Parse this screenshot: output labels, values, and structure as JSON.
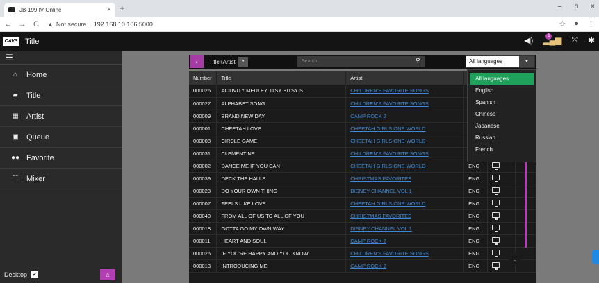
{
  "browser": {
    "tab_title": "JB-199 IV Online",
    "tab_close": "×",
    "new_tab": "+",
    "url_warning": "Not secure",
    "url_separator": "|",
    "url_host": "192.168.10.106:5000",
    "win_min": "–",
    "win_max": "ɑ",
    "win_close": "×"
  },
  "appbar": {
    "logo": "CAVS",
    "title": "Title",
    "badge_count": "1"
  },
  "sidebar": {
    "items": [
      {
        "label": "Home",
        "icon": "home-icon"
      },
      {
        "label": "Title",
        "icon": "book-icon"
      },
      {
        "label": "Artist",
        "icon": "grid-icon"
      },
      {
        "label": "Queue",
        "icon": "queue-icon"
      },
      {
        "label": "Favorite",
        "icon": "users-icon"
      },
      {
        "label": "Mixer",
        "icon": "sliders-icon"
      }
    ],
    "desktop_label": "Desktop"
  },
  "toolbar": {
    "search_type": "Title+Artist",
    "search_placeholder": "Search...",
    "language_selected": "All languages"
  },
  "table": {
    "headers": [
      "Number",
      "Title",
      "Artist"
    ],
    "rows": [
      {
        "number": "000026",
        "title": "ACTIVITY MEDLEY: ITSY BITSY S",
        "artist": "CHILDREN'S FAVORITE SONGS",
        "lang": ""
      },
      {
        "number": "000027",
        "title": "ALPHABET SONG",
        "artist": "CHILDREN'S FAVORITE SONGS",
        "lang": ""
      },
      {
        "number": "000009",
        "title": "BRAND NEW DAY",
        "artist": "CAMP ROCK 2",
        "lang": ""
      },
      {
        "number": "000001",
        "title": "CHEETAH LOVE",
        "artist": "CHEETAH GIRLS ONE WORLD",
        "lang": ""
      },
      {
        "number": "000008",
        "title": "CIRCLE GAME",
        "artist": "CHEETAH GIRLS ONE WORLD",
        "lang": ""
      },
      {
        "number": "000031",
        "title": "CLEMENTINE",
        "artist": "CHILDREN'S FAVORITE SONGS",
        "lang": ""
      },
      {
        "number": "000002",
        "title": "DANCE ME IF YOU CAN",
        "artist": "CHEETAH GIRLS ONE WORLD",
        "lang": "ENG"
      },
      {
        "number": "000039",
        "title": "DECK THE HALLS",
        "artist": "CHRISTMAS FAVORITES",
        "lang": "ENG"
      },
      {
        "number": "000023",
        "title": "DO YOUR OWN THING",
        "artist": "DISNEY CHANNEL VOL 1",
        "lang": "ENG"
      },
      {
        "number": "000007",
        "title": "FEELS LIKE LOVE",
        "artist": "CHEETAH GIRLS ONE WORLD",
        "lang": "ENG"
      },
      {
        "number": "000040",
        "title": "FROM ALL OF US TO ALL OF YOU",
        "artist": "CHRISTMAS FAVORITES",
        "lang": "ENG"
      },
      {
        "number": "000018",
        "title": "GOTTA GO MY OWN WAY",
        "artist": "DISNEY CHANNEL VOL 1",
        "lang": "ENG"
      },
      {
        "number": "000011",
        "title": "HEART AND SOUL",
        "artist": "CAMP ROCK 2",
        "lang": "ENG"
      },
      {
        "number": "000025",
        "title": "IF YOU'RE HAPPY AND YOU KNOW",
        "artist": "CHILDREN'S FAVORITE SONGS",
        "lang": "ENG"
      },
      {
        "number": "000013",
        "title": "INTRODUCING ME",
        "artist": "CAMP ROCK 2",
        "lang": "ENG"
      }
    ]
  },
  "language_dropdown": {
    "options": [
      "All languages",
      "English",
      "Spanish",
      "Chinese",
      "Japanese",
      "Russian",
      "French"
    ]
  },
  "colors": {
    "accent": "#b340b3",
    "selected": "#1fa15b",
    "link": "#3f8ad8"
  }
}
